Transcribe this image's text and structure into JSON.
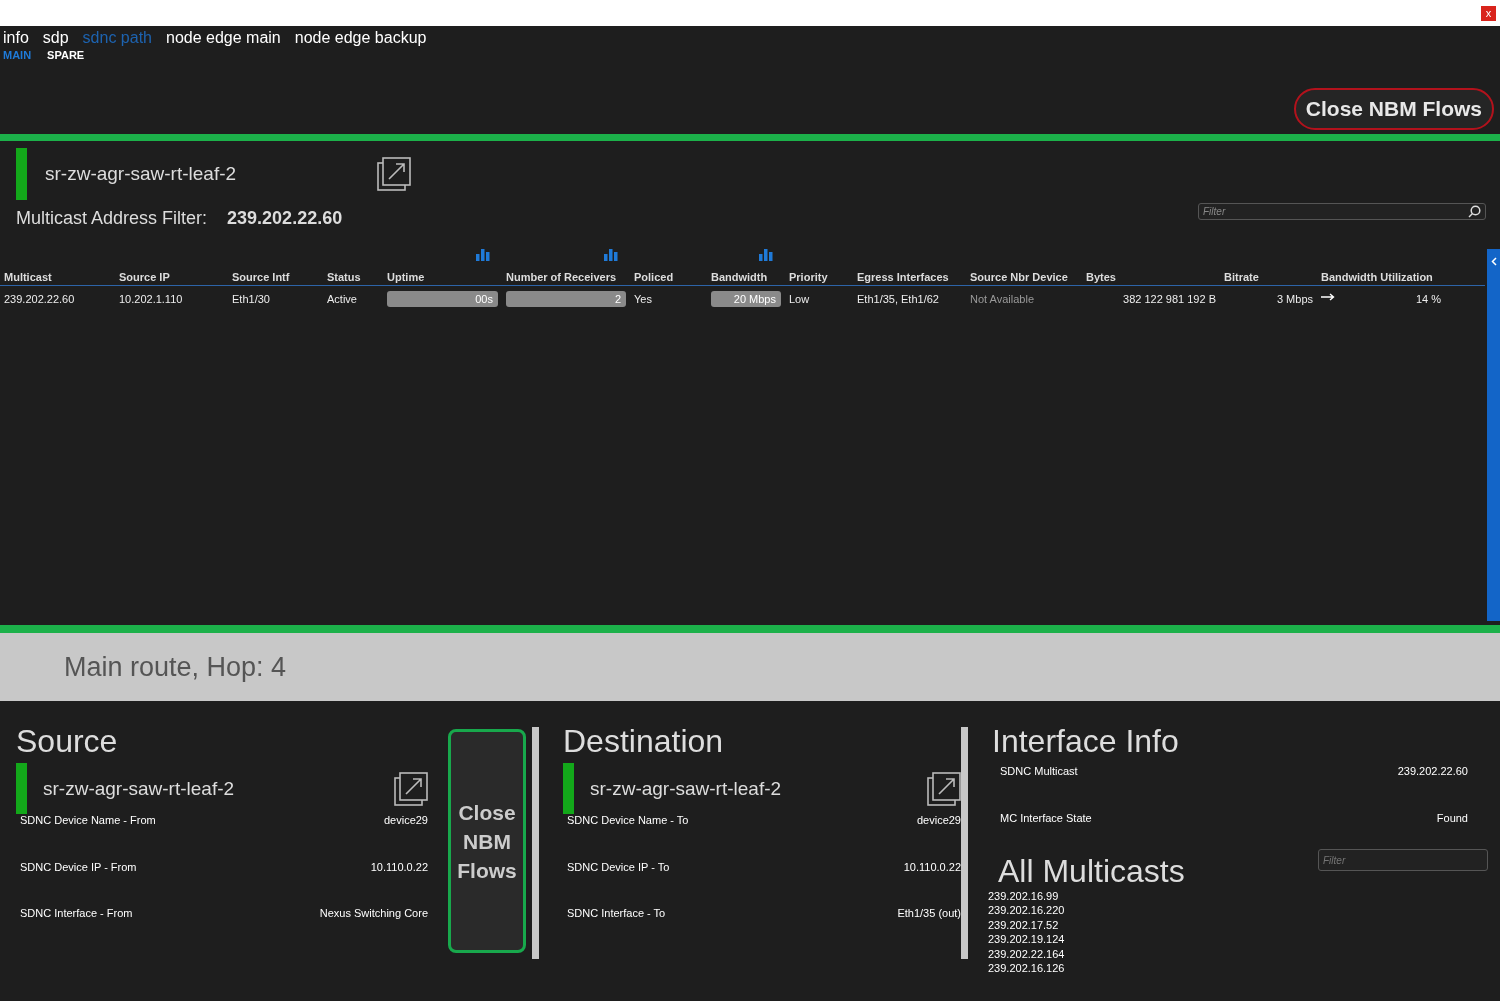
{
  "window": {
    "close_label": "x"
  },
  "tabs": [
    {
      "label": "info",
      "selected": false
    },
    {
      "label": "sdp",
      "selected": false
    },
    {
      "label": "sdnc path",
      "selected": true
    },
    {
      "label": "node edge main",
      "selected": false
    },
    {
      "label": "node edge backup",
      "selected": false
    }
  ],
  "subtabs": [
    {
      "label": "MAIN",
      "selected": true
    },
    {
      "label": "SPARE",
      "selected": false
    }
  ],
  "close_button": "Close NBM Flows",
  "device": {
    "name": "sr-zw-agr-saw-rt-leaf-2",
    "active": true,
    "filter_label": "Multicast Address Filter:",
    "filter_value": "239.202.22.60",
    "search": {
      "placeholder": "Filter"
    }
  },
  "table": {
    "columns": [
      {
        "label": "Multicast",
        "kind": "plain"
      },
      {
        "label": "Source IP",
        "kind": "plain"
      },
      {
        "label": "Source Intf",
        "kind": "plain"
      },
      {
        "label": "Status",
        "kind": "plain"
      },
      {
        "label": "Uptime",
        "kind": "chart"
      },
      {
        "label": "Number of Receivers",
        "kind": "chart"
      },
      {
        "label": "Policed",
        "kind": "plain"
      },
      {
        "label": "Bandwidth",
        "kind": "chart"
      },
      {
        "label": "Priority",
        "kind": "plain"
      },
      {
        "label": "Egress Interfaces",
        "kind": "plain"
      },
      {
        "label": "Source Nbr Device",
        "kind": "plain"
      },
      {
        "label": "Bytes",
        "kind": "plain"
      },
      {
        "label": "Bitrate",
        "kind": "plain"
      },
      {
        "label": "Bandwidth Utilization",
        "kind": "plain"
      }
    ],
    "rows": [
      {
        "cells": [
          {
            "kind": "text",
            "text": "239.202.22.60"
          },
          {
            "kind": "text",
            "text": "10.202.1.110"
          },
          {
            "kind": "text",
            "text": "Eth1/30"
          },
          {
            "kind": "text",
            "text": "Active"
          },
          {
            "kind": "pill",
            "text": "00s"
          },
          {
            "kind": "pill",
            "text": "2"
          },
          {
            "kind": "text",
            "text": "Yes"
          },
          {
            "kind": "pill",
            "text": "20 Mbps"
          },
          {
            "kind": "text",
            "text": "Low"
          },
          {
            "kind": "text",
            "text": "Eth1/35, Eth1/62"
          },
          {
            "kind": "muted",
            "text": "Not Available"
          },
          {
            "kind": "right",
            "text": "382 122 981 192 B"
          },
          {
            "kind": "right",
            "text": "3 Mbps"
          },
          {
            "kind": "trend",
            "text": "14 %"
          }
        ]
      }
    ]
  },
  "route": {
    "title": "Main route, Hop: 4"
  },
  "source": {
    "title": "Source",
    "device": "sr-zw-agr-saw-rt-leaf-2",
    "active": true,
    "fields": [
      {
        "label": "SDNC Device Name - From",
        "value": "device29"
      },
      {
        "label": "SDNC Device IP - From",
        "value": "10.110.0.22"
      },
      {
        "label": "SDNC Interface - From",
        "value": "Nexus Switching Core"
      }
    ]
  },
  "close_flows_button": "Close NBM Flows",
  "destination": {
    "title": "Destination",
    "device": "sr-zw-agr-saw-rt-leaf-2",
    "active": true,
    "fields": [
      {
        "label": "SDNC Device Name - To",
        "value": "device29"
      },
      {
        "label": "SDNC Device IP - To",
        "value": "10.110.0.22"
      },
      {
        "label": "SDNC Interface - To",
        "value": "Eth1/35 (out)"
      }
    ]
  },
  "interface_info": {
    "title": "Interface Info",
    "fields": [
      {
        "label": "SDNC Multicast",
        "value": "239.202.22.60"
      },
      {
        "label": "MC Interface State",
        "value": "Found"
      }
    ]
  },
  "all_multicasts": {
    "title": "All Multicasts",
    "search": {
      "placeholder": "Filter"
    },
    "items": [
      "239.202.16.99",
      "239.202.16.220",
      "239.202.17.52",
      "239.202.19.124",
      "239.202.22.164",
      "239.202.16.126"
    ]
  }
}
